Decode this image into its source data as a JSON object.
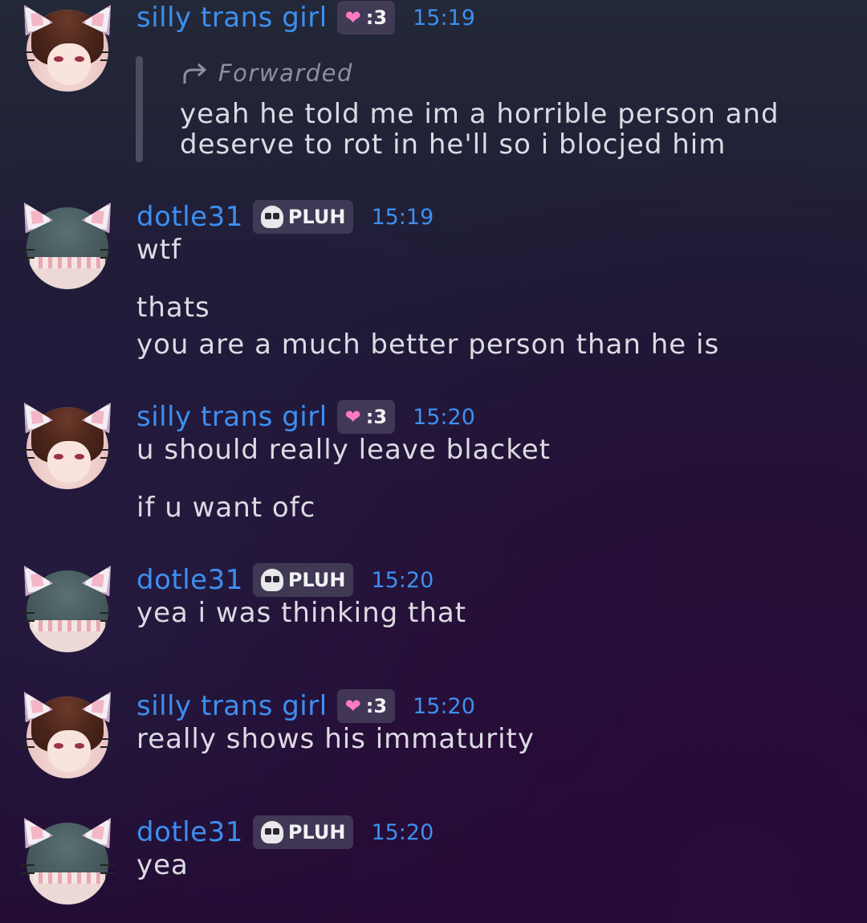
{
  "users": {
    "girl": {
      "name": "silly trans girl",
      "badge": ":3",
      "badge_icon": "heart-icon"
    },
    "dotle": {
      "name": "dotle31",
      "badge": "PLUH",
      "badge_icon": "skull-icon"
    }
  },
  "colors": {
    "username": "#3d8ff0",
    "timestamp": "#3d8ff0",
    "text": "#dcdbe3",
    "forward_label": "#8f909c"
  },
  "messages": [
    {
      "author": "silly trans girl",
      "badge": ":3",
      "time": "15:19",
      "forwarded_label": "Forwarded",
      "forwarded_lines": [
        "yeah he told me im a horrible person and",
        "deserve to rot in he'll so i blocjed him"
      ]
    },
    {
      "author": "dotle31",
      "badge": "PLUH",
      "time": "15:19",
      "lines": [
        "wtf",
        "thats",
        "you are a much better person than he is"
      ]
    },
    {
      "author": "silly trans girl",
      "badge": ":3",
      "time": "15:20",
      "lines": [
        "u should really leave blacket",
        "if u want ofc"
      ]
    },
    {
      "author": "dotle31",
      "badge": "PLUH",
      "time": "15:20",
      "lines": [
        "yea i was thinking that"
      ]
    },
    {
      "author": "silly trans girl",
      "badge": ":3",
      "time": "15:20",
      "lines": [
        "really shows his immaturity"
      ]
    },
    {
      "author": "dotle31",
      "badge": "PLUH",
      "time": "15:20",
      "lines": [
        "yea"
      ]
    }
  ]
}
